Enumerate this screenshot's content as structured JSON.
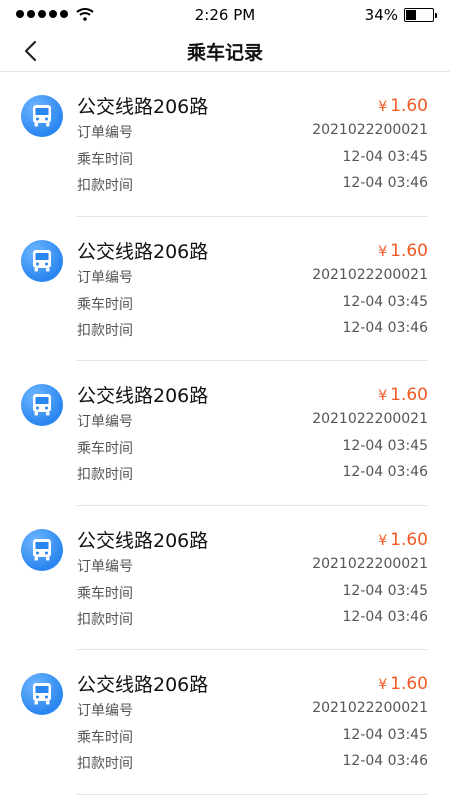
{
  "status_bar": {
    "time": "2:26 PM",
    "battery_percent": "34%",
    "battery_level": 0.34
  },
  "nav": {
    "title": "乘车记录"
  },
  "labels": {
    "order_no": "订单编号",
    "ride_time": "乘车时间",
    "deduct_time": "扣款时间",
    "currency": "¥"
  },
  "rides": [
    {
      "route": "公交线路206路",
      "price": "1.60",
      "order_no": "2021022200021",
      "ride_time": "12-04 03:45",
      "deduct_time": "12-04 03:46"
    },
    {
      "route": "公交线路206路",
      "price": "1.60",
      "order_no": "2021022200021",
      "ride_time": "12-04 03:45",
      "deduct_time": "12-04 03:46"
    },
    {
      "route": "公交线路206路",
      "price": "1.60",
      "order_no": "2021022200021",
      "ride_time": "12-04 03:45",
      "deduct_time": "12-04 03:46"
    },
    {
      "route": "公交线路206路",
      "price": "1.60",
      "order_no": "2021022200021",
      "ride_time": "12-04 03:45",
      "deduct_time": "12-04 03:46"
    },
    {
      "route": "公交线路206路",
      "price": "1.60",
      "order_no": "2021022200021",
      "ride_time": "12-04 03:45",
      "deduct_time": "12-04 03:46"
    }
  ],
  "colors": {
    "accent_price": "#f25a22",
    "bus_icon": "#2a86f0"
  },
  "icons": {
    "back": "chevron-left-icon",
    "bus": "bus-icon"
  }
}
